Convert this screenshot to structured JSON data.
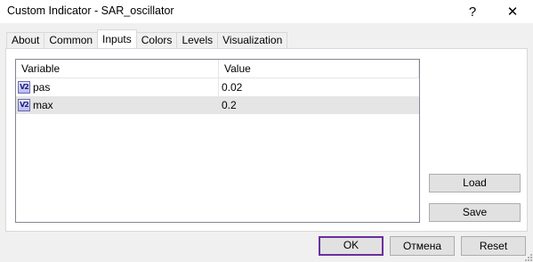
{
  "window": {
    "title": "Custom Indicator - SAR_oscillator",
    "help_glyph": "?",
    "close_glyph": "✕"
  },
  "tabs": [
    {
      "label": "About",
      "active": false
    },
    {
      "label": "Common",
      "active": false
    },
    {
      "label": "Inputs",
      "active": true
    },
    {
      "label": "Colors",
      "active": false
    },
    {
      "label": "Levels",
      "active": false
    },
    {
      "label": "Visualization",
      "active": false
    }
  ],
  "grid": {
    "columns": [
      "Variable",
      "Value"
    ],
    "rows": [
      {
        "icon": "double-variable-icon",
        "icon_text": "V2",
        "variable": "pas",
        "value": "0.02",
        "selected": false
      },
      {
        "icon": "double-variable-icon",
        "icon_text": "V2",
        "variable": "max",
        "value": "0.2",
        "selected": true
      }
    ]
  },
  "side_buttons": {
    "load": "Load",
    "save": "Save"
  },
  "footer_buttons": {
    "ok": "OK",
    "cancel": "Отмена",
    "reset": "Reset"
  },
  "colors": {
    "default_button_border": "#6a2f9e",
    "selected_row": "#e5e5e5",
    "icon_border": "#6a6ab0"
  }
}
